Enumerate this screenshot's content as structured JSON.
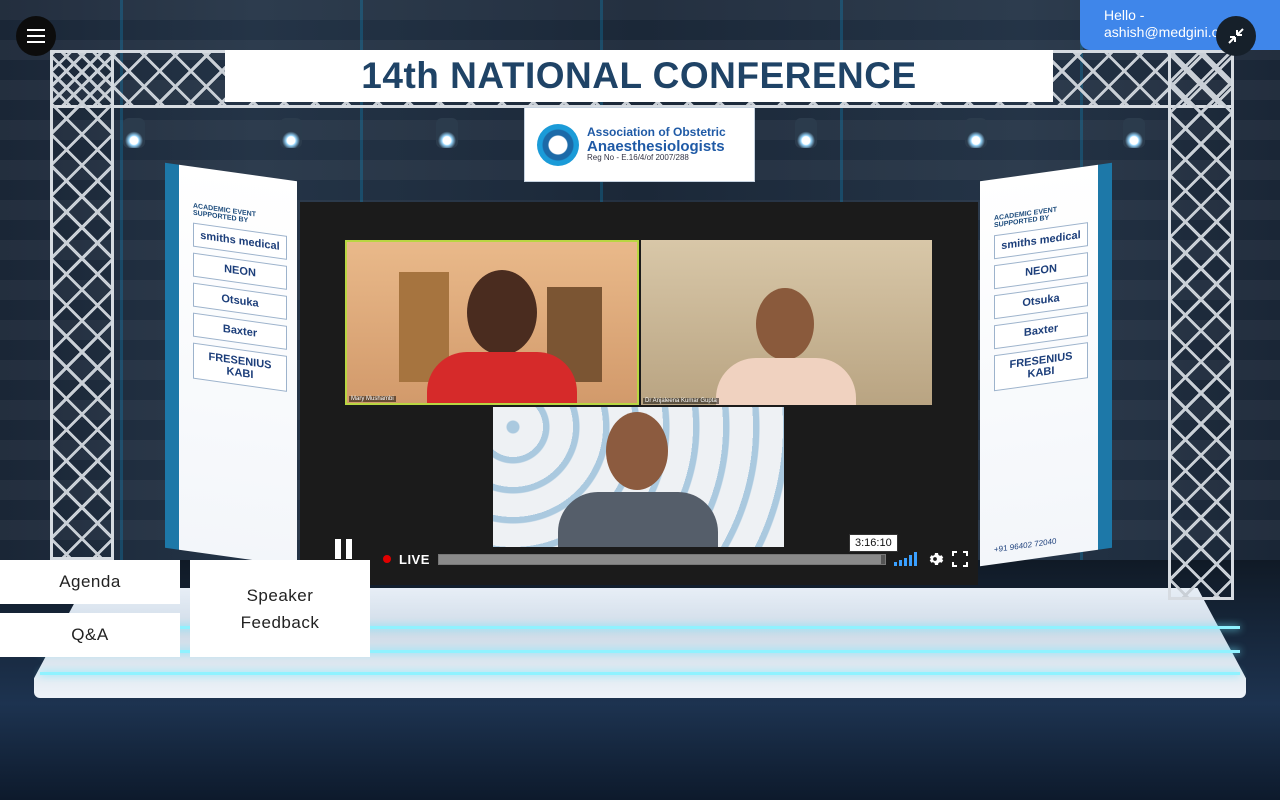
{
  "user": {
    "greeting": "Hello -",
    "email": "ashish@medgini.com"
  },
  "event": {
    "title": "14th NATIONAL CONFERENCE",
    "organization_line1": "Association of Obstetric",
    "organization_line2": "Anaesthesiologists",
    "organization_reg": "Reg No - E.16/4/of 2007/288"
  },
  "sponsors": {
    "heading": "ACADEMIC EVENT SUPPORTED BY",
    "logos": [
      "smiths medical",
      "NEON",
      "Otsuka",
      "Baxter",
      "FRESENIUS KABI"
    ],
    "phone": "+91 96402 72040"
  },
  "video": {
    "participants": [
      "Mary Mushambi",
      "Dr Anjaleena Kumar Gupta",
      ""
    ],
    "live_label": "LIVE",
    "time_tooltip": "3:16:10",
    "progress_fraction": 0.99
  },
  "buttons": {
    "agenda": "Agenda",
    "qa": "Q&A",
    "speaker_feedback": "Speaker Feedback"
  }
}
